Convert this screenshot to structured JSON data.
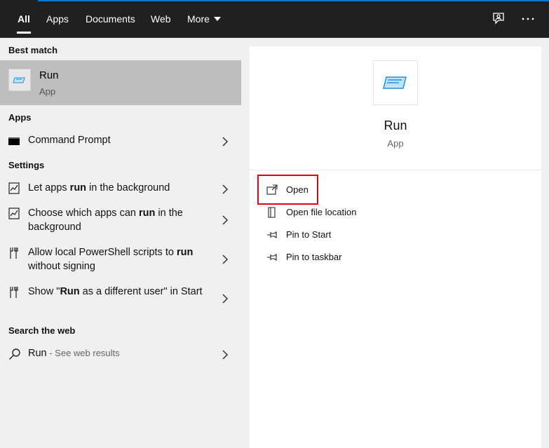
{
  "topbar": {
    "tabs": [
      {
        "label": "All"
      },
      {
        "label": "Apps"
      },
      {
        "label": "Documents"
      },
      {
        "label": "Web"
      },
      {
        "label": "More"
      }
    ],
    "icons": {
      "feedback": "feedback-icon",
      "more_options": "ellipsis-icon"
    }
  },
  "left": {
    "best_match_heading": "Best match",
    "best_match": {
      "title": "Run",
      "subtitle": "App",
      "icon": "run-app-icon"
    },
    "apps_heading": "Apps",
    "apps": [
      {
        "label": "Command Prompt",
        "icon": "command-prompt-icon"
      }
    ],
    "settings_heading": "Settings",
    "settings": [
      {
        "pre": "Let apps ",
        "bold": "run",
        "post": " in the background",
        "icon": "settings-app-icon"
      },
      {
        "pre": "Choose which apps can ",
        "bold": "run",
        "post": " in the background",
        "icon": "settings-app-icon"
      },
      {
        "pre": "Allow local PowerShell scripts to ",
        "bold": "run",
        "post": " without signing",
        "icon": "developer-tools-icon"
      },
      {
        "pre": "Show \"",
        "bold": "Run",
        "post": " as a different user\" in Start",
        "icon": "developer-tools-icon"
      }
    ],
    "web_heading": "Search the web",
    "web": {
      "label": "Run",
      "suffix": " - See web results",
      "icon": "search-icon"
    }
  },
  "right": {
    "title": "Run",
    "subtitle": "App",
    "actions": [
      {
        "label": "Open",
        "icon": "open-icon"
      },
      {
        "label": "Open file location",
        "icon": "file-location-icon"
      },
      {
        "label": "Pin to Start",
        "icon": "pin-icon"
      },
      {
        "label": "Pin to taskbar",
        "icon": "pin-icon"
      }
    ]
  },
  "colors": {
    "accent": "#0a78d7",
    "highlight": "#e0000f",
    "selected": "#bebebe",
    "topbar": "#202020"
  }
}
